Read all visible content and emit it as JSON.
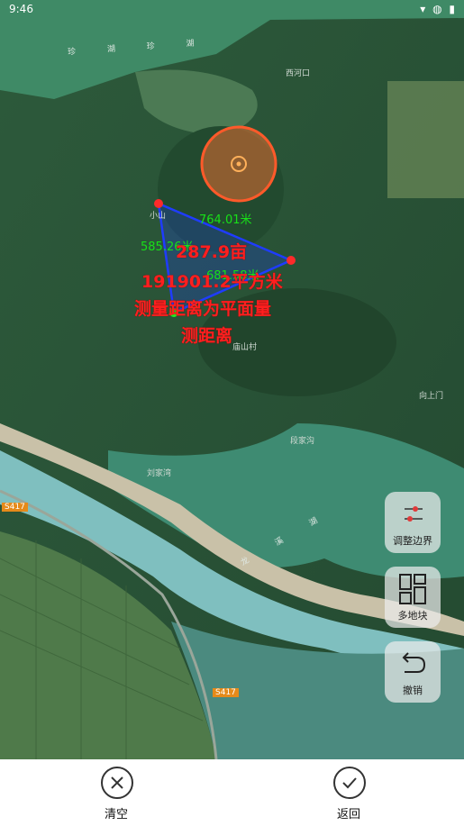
{
  "status_bar": {
    "time": "9:46",
    "icons": "▾ ◍ ▮"
  },
  "map": {
    "labels": [
      "珍 湖 珍 湖",
      "西河口",
      "小山",
      "庙山村",
      "向上门",
      "段家沟",
      "刘家湾",
      "龙 溪 湖",
      "S417",
      "S417"
    ],
    "measurements": {
      "segment_1": "764.01米",
      "segment_2": "585.26米",
      "segment_3": "681.58米",
      "area_mu": "287.9亩",
      "area_m2": "191901.2平方米",
      "note_line1": "测量距离为平面量",
      "note_line2": "测距离"
    }
  },
  "side_buttons": {
    "adjust": "调整边界",
    "multi": "多地块",
    "undo": "撤销"
  },
  "bottom_bar": {
    "clear": "清空",
    "back": "返回"
  },
  "colors": {
    "polygon": "#1f3cff",
    "vertex": "#ff2a2a",
    "text_red": "#ff1f1f",
    "text_green": "#18e018"
  }
}
